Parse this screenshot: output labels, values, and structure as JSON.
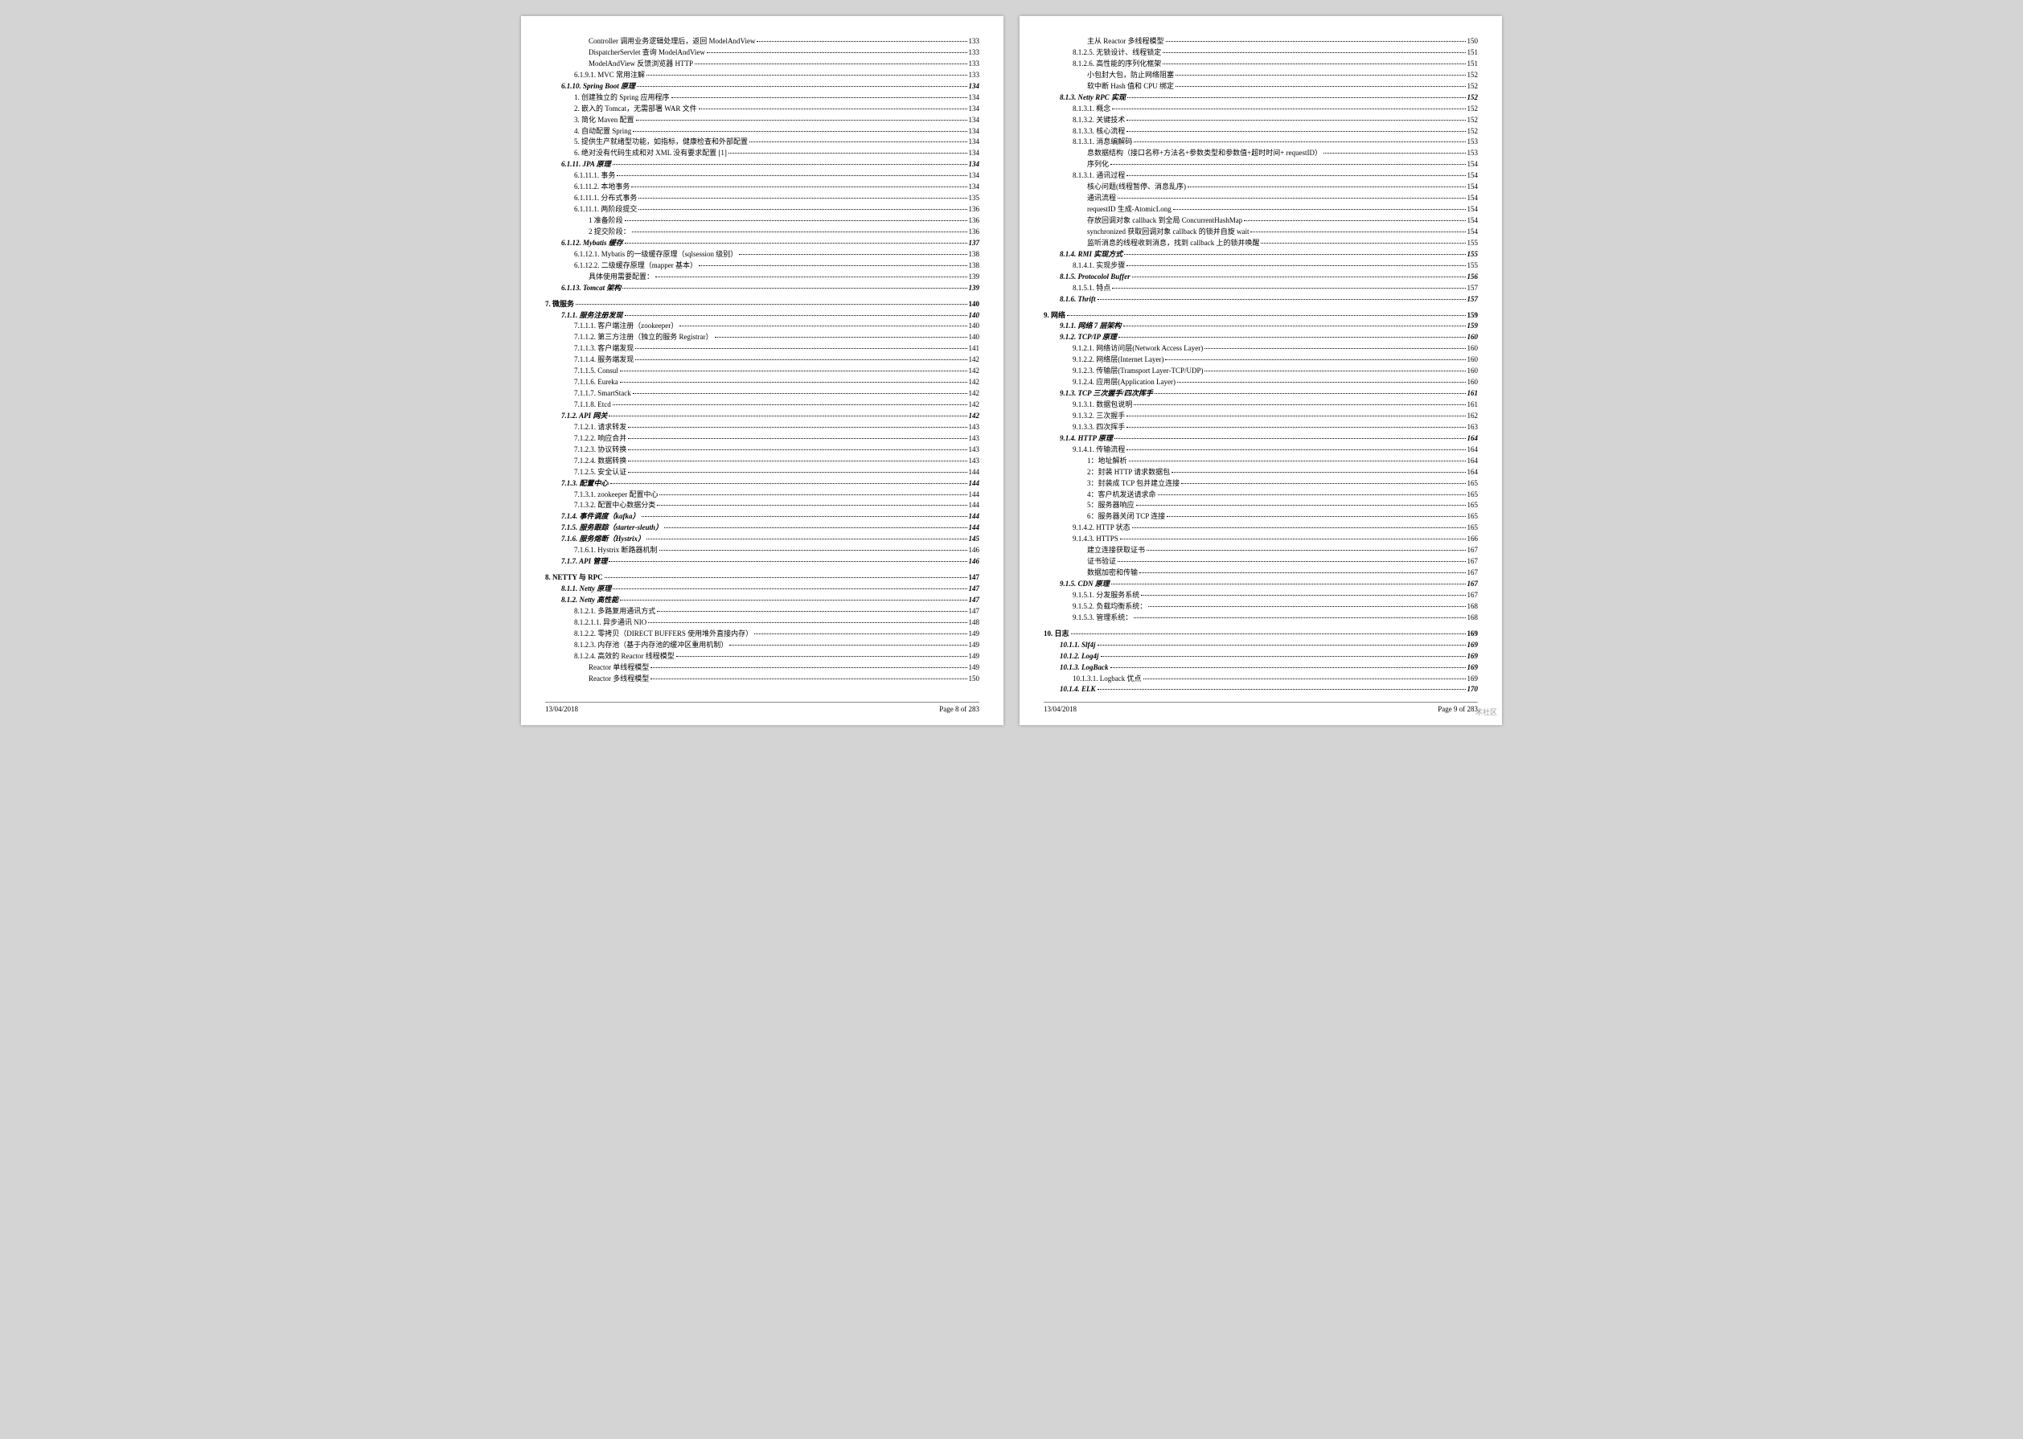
{
  "footer": {
    "date": "13/04/2018",
    "page_left": "Page 8 of 283",
    "page_right": "Page 9 of 283"
  },
  "watermark": "术社区",
  "left": [
    {
      "lvl": 3,
      "label": "Controller 调用业务逻辑处理后，返回 ModelAndView",
      "pg": "133"
    },
    {
      "lvl": 3,
      "label": "DispatcherServlet 查询 ModelAndView",
      "pg": "133"
    },
    {
      "lvl": 3,
      "label": "ModelAndView 反馈浏览器 HTTP",
      "pg": "133"
    },
    {
      "lvl": 2,
      "label": "6.1.9.1.    MVC 常用注解",
      "pg": "133"
    },
    {
      "lvl": 1,
      "label": "6.1.10.    Spring Boot 原理",
      "pg": "134"
    },
    {
      "lvl": 2,
      "label": "1. 创建独立的 Spring 应用程序",
      "pg": "134"
    },
    {
      "lvl": 2,
      "label": "2. 嵌入的 Tomcat，无需部署 WAR 文件",
      "pg": "134"
    },
    {
      "lvl": 2,
      "label": "3. 简化 Maven 配置",
      "pg": "134"
    },
    {
      "lvl": 2,
      "label": "4. 自动配置 Spring",
      "pg": "134"
    },
    {
      "lvl": 2,
      "label": "5. 提供生产就绪型功能，如指标，健康检查和外部配置",
      "pg": "134"
    },
    {
      "lvl": 2,
      "label": "6. 绝对没有代码生成和对 XML 没有要求配置 [1]",
      "pg": "134"
    },
    {
      "lvl": 1,
      "label": "6.1.11.    JPA 原理",
      "pg": "134"
    },
    {
      "lvl": 2,
      "label": "6.1.11.1.      事务",
      "pg": "134"
    },
    {
      "lvl": 2,
      "label": "6.1.11.2.      本地事务",
      "pg": "134"
    },
    {
      "lvl": 2,
      "label": "6.1.11.1.      分布式事务",
      "pg": "135"
    },
    {
      "lvl": 2,
      "label": "6.1.11.1.      两阶段提交",
      "pg": "136"
    },
    {
      "lvl": 3,
      "label": "1 准备阶段",
      "pg": "136"
    },
    {
      "lvl": 3,
      "label": "2 提交阶段：",
      "pg": "136"
    },
    {
      "lvl": 1,
      "label": "6.1.12.    Mybatis 缓存",
      "pg": "137"
    },
    {
      "lvl": 2,
      "label": "6.1.12.1.      Mybatis 的一级缓存原理（sqlsession 级别）",
      "pg": "138"
    },
    {
      "lvl": 2,
      "label": "6.1.12.2.      二级缓存原理（mapper 基本）",
      "pg": "138"
    },
    {
      "lvl": 3,
      "label": "具体使用需要配置：",
      "pg": "139"
    },
    {
      "lvl": 1,
      "label": "6.1.13.    Tomcat 架构",
      "pg": "139"
    },
    {
      "lvl": 0,
      "label": "7.    微服务",
      "pg": "140"
    },
    {
      "lvl": 1,
      "label": "7.1.1.    服务注册发现",
      "pg": "140"
    },
    {
      "lvl": 2,
      "label": "7.1.1.1.    客户端注册（zookeeper）",
      "pg": "140"
    },
    {
      "lvl": 2,
      "label": "7.1.1.2.    第三方注册（独立的服务 Registrar）",
      "pg": "140"
    },
    {
      "lvl": 2,
      "label": "7.1.1.3.    客户端发现",
      "pg": "141"
    },
    {
      "lvl": 2,
      "label": "7.1.1.4.    服务端发现",
      "pg": "142"
    },
    {
      "lvl": 2,
      "label": "7.1.1.5.    Consul",
      "pg": "142"
    },
    {
      "lvl": 2,
      "label": "7.1.1.6.    Eureka",
      "pg": "142"
    },
    {
      "lvl": 2,
      "label": "7.1.1.7.    SmartStack",
      "pg": "142"
    },
    {
      "lvl": 2,
      "label": "7.1.1.8.    Etcd",
      "pg": "142"
    },
    {
      "lvl": 1,
      "label": "7.1.2.    API 网关",
      "pg": "142"
    },
    {
      "lvl": 2,
      "label": "7.1.2.1.    请求转发",
      "pg": "143"
    },
    {
      "lvl": 2,
      "label": "7.1.2.2.    响应合并",
      "pg": "143"
    },
    {
      "lvl": 2,
      "label": "7.1.2.3.    协议转换",
      "pg": "143"
    },
    {
      "lvl": 2,
      "label": "7.1.2.4.    数据转换",
      "pg": "143"
    },
    {
      "lvl": 2,
      "label": "7.1.2.5.    安全认证",
      "pg": "144"
    },
    {
      "lvl": 1,
      "label": "7.1.3.    配置中心",
      "pg": "144"
    },
    {
      "lvl": 2,
      "label": "7.1.3.1.    zookeeper 配置中心",
      "pg": "144"
    },
    {
      "lvl": 2,
      "label": "7.1.3.2.    配置中心数据分类",
      "pg": "144"
    },
    {
      "lvl": 1,
      "label": "7.1.4.    事件调度（kafka）",
      "pg": "144"
    },
    {
      "lvl": 1,
      "label": "7.1.5.    服务跟踪（starter-sleuth）",
      "pg": "144"
    },
    {
      "lvl": 1,
      "label": "7.1.6.    服务熔断（Hystrix）",
      "pg": "145"
    },
    {
      "lvl": 2,
      "label": "7.1.6.1.    Hystrix 断路器机制",
      "pg": "146"
    },
    {
      "lvl": 1,
      "label": "7.1.7.    API 管理",
      "pg": "146"
    },
    {
      "lvl": 0,
      "label": "8.    NETTY 与 RPC",
      "pg": "147"
    },
    {
      "lvl": 1,
      "label": "8.1.1.    Netty 原理",
      "pg": "147"
    },
    {
      "lvl": 1,
      "label": "8.1.2.    Netty 高性能",
      "pg": "147"
    },
    {
      "lvl": 2,
      "label": "8.1.2.1.      多路复用通讯方式",
      "pg": "147"
    },
    {
      "lvl": 2,
      "label": "8.1.2.1.1.        异步通讯 NIO",
      "pg": "148"
    },
    {
      "lvl": 2,
      "label": "8.1.2.2.      零拷贝（DIRECT BUFFERS 使用堆外直接内存）",
      "pg": "149"
    },
    {
      "lvl": 2,
      "label": "8.1.2.3.      内存池（基于内存池的缓冲区重用机制）",
      "pg": "149"
    },
    {
      "lvl": 2,
      "label": "8.1.2.4.      高效的 Reactor 线程模型",
      "pg": "149"
    },
    {
      "lvl": 3,
      "label": "Reactor 单线程模型",
      "pg": "149"
    },
    {
      "lvl": 3,
      "label": "Reactor 多线程模型",
      "pg": "150"
    }
  ],
  "right": [
    {
      "lvl": 3,
      "label": "主从 Reactor 多线程模型",
      "pg": "150"
    },
    {
      "lvl": 2,
      "label": "8.1.2.5.      无锁设计、线程锁定",
      "pg": "151"
    },
    {
      "lvl": 2,
      "label": "8.1.2.6.      高性能的序列化框架",
      "pg": "151"
    },
    {
      "lvl": 3,
      "label": "小包封大包，防止网络阻塞",
      "pg": "152"
    },
    {
      "lvl": 3,
      "label": "软中断 Hash 值和 CPU 绑定",
      "pg": "152"
    },
    {
      "lvl": 1,
      "label": "8.1.3.    Netty RPC 实现",
      "pg": "152"
    },
    {
      "lvl": 2,
      "label": "8.1.3.1.    概念",
      "pg": "152"
    },
    {
      "lvl": 2,
      "label": "8.1.3.2.    关键技术",
      "pg": "152"
    },
    {
      "lvl": 2,
      "label": "8.1.3.3.    核心流程",
      "pg": "152"
    },
    {
      "lvl": 2,
      "label": "8.1.3.1.    消息编解码",
      "pg": "153"
    },
    {
      "lvl": 3,
      "label": "息数据结构（接口名称+方法名+参数类型和参数值+超时时间+ requestID）",
      "pg": "153"
    },
    {
      "lvl": 3,
      "label": "序列化",
      "pg": "154"
    },
    {
      "lvl": 2,
      "label": "8.1.3.1.    通讯过程",
      "pg": "154"
    },
    {
      "lvl": 3,
      "label": "核心问题(线程暂停、消息乱序)",
      "pg": "154"
    },
    {
      "lvl": 3,
      "label": "通讯流程",
      "pg": "154"
    },
    {
      "lvl": 3,
      "label": "requestID 生成-AtomicLong",
      "pg": "154"
    },
    {
      "lvl": 3,
      "label": "存放回调对象 callback 到全局 ConcurrentHashMap",
      "pg": "154"
    },
    {
      "lvl": 3,
      "label": "synchronized 获取回调对象 callback 的锁并自旋 wait",
      "pg": "154"
    },
    {
      "lvl": 3,
      "label": "监听消息的线程收到消息，找到 callback 上的锁并唤醒",
      "pg": "155"
    },
    {
      "lvl": 1,
      "label": "8.1.4.    RMI 实现方式",
      "pg": "155"
    },
    {
      "lvl": 2,
      "label": "8.1.4.1.    实现步骤",
      "pg": "155"
    },
    {
      "lvl": 1,
      "label": "8.1.5.    Protocolol Buffer",
      "pg": "156"
    },
    {
      "lvl": 2,
      "label": "8.1.5.1.    特点",
      "pg": "157"
    },
    {
      "lvl": 1,
      "label": "8.1.6.    Thrift",
      "pg": "157"
    },
    {
      "lvl": 0,
      "label": "9.    网络",
      "pg": "159"
    },
    {
      "lvl": 1,
      "label": "9.1.1.    网络 7 层架构",
      "pg": "159"
    },
    {
      "lvl": 1,
      "label": "9.1.2.    TCP/IP 原理",
      "pg": "160"
    },
    {
      "lvl": 2,
      "label": "9.1.2.1.    网络访问层(Network Access Layer)",
      "pg": "160"
    },
    {
      "lvl": 2,
      "label": "9.1.2.2.    网络层(Internet Layer)",
      "pg": "160"
    },
    {
      "lvl": 2,
      "label": "9.1.2.3.    传输层(Tramsport Layer-TCP/UDP)",
      "pg": "160"
    },
    {
      "lvl": 2,
      "label": "9.1.2.4.    应用层(Application Layer)",
      "pg": "160"
    },
    {
      "lvl": 1,
      "label": "9.1.3.    TCP 三次握手/四次挥手",
      "pg": "161"
    },
    {
      "lvl": 2,
      "label": "9.1.3.1.    数据包说明",
      "pg": "161"
    },
    {
      "lvl": 2,
      "label": "9.1.3.2.    三次握手",
      "pg": "162"
    },
    {
      "lvl": 2,
      "label": "9.1.3.3.    四次挥手",
      "pg": "163"
    },
    {
      "lvl": 1,
      "label": "9.1.4.    HTTP 原理",
      "pg": "164"
    },
    {
      "lvl": 2,
      "label": "9.1.4.1.    传输流程",
      "pg": "164"
    },
    {
      "lvl": 3,
      "label": "1：地址解析",
      "pg": "164"
    },
    {
      "lvl": 3,
      "label": "2：封装 HTTP 请求数据包",
      "pg": "164"
    },
    {
      "lvl": 3,
      "label": "3：封装成 TCP 包并建立连接",
      "pg": "165"
    },
    {
      "lvl": 3,
      "label": "4：客户机发送请求命",
      "pg": "165"
    },
    {
      "lvl": 3,
      "label": "5：服务器响应",
      "pg": "165"
    },
    {
      "lvl": 3,
      "label": "6：服务器关闭 TCP 连接",
      "pg": "165"
    },
    {
      "lvl": 2,
      "label": "9.1.4.2.    HTTP 状态",
      "pg": "165"
    },
    {
      "lvl": 2,
      "label": "9.1.4.3.    HTTPS",
      "pg": "166"
    },
    {
      "lvl": 3,
      "label": "建立连接获取证书",
      "pg": "167"
    },
    {
      "lvl": 3,
      "label": "证书验证",
      "pg": "167"
    },
    {
      "lvl": 3,
      "label": "数据加密和传输",
      "pg": "167"
    },
    {
      "lvl": 1,
      "label": "9.1.5.    CDN 原理",
      "pg": "167"
    },
    {
      "lvl": 2,
      "label": "9.1.5.1.    分发服务系统",
      "pg": "167"
    },
    {
      "lvl": 2,
      "label": "9.1.5.2.    负载均衡系统：",
      "pg": "168"
    },
    {
      "lvl": 2,
      "label": "9.1.5.3.    管理系统：",
      "pg": "168"
    },
    {
      "lvl": 0,
      "label": "10.    日志",
      "pg": "169"
    },
    {
      "lvl": 1,
      "label": "10.1.1.    Slf4j",
      "pg": "169"
    },
    {
      "lvl": 1,
      "label": "10.1.2.    Log4j",
      "pg": "169"
    },
    {
      "lvl": 1,
      "label": "10.1.3.    LogBack",
      "pg": "169"
    },
    {
      "lvl": 2,
      "label": "10.1.3.1.      Logback 优点",
      "pg": "169"
    },
    {
      "lvl": 1,
      "label": "10.1.4.    ELK",
      "pg": "170"
    }
  ]
}
